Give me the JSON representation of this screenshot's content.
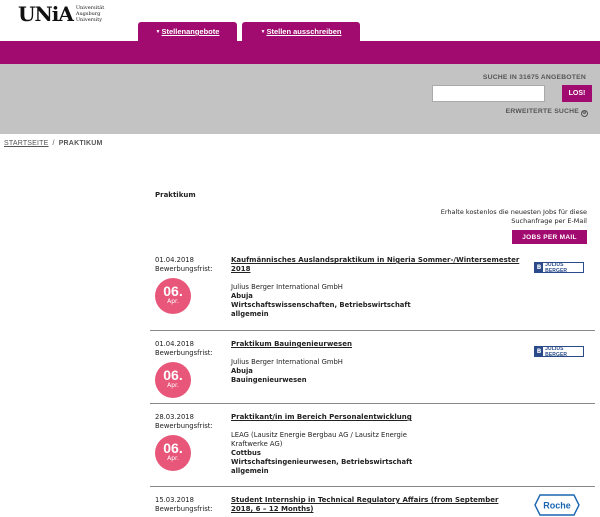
{
  "header": {
    "logo_mark": "UNiA",
    "logo_lines": [
      "Universität",
      "Augsburg",
      "University"
    ],
    "tabs": [
      {
        "label": "Stellenangebote"
      },
      {
        "label": "Stellen ausschreiben"
      }
    ]
  },
  "search": {
    "count_text": "SUCHE IN 31675 ANGEBOTEN",
    "input_value": "",
    "button_label": "LOS!",
    "advanced_label": "ERWEITERTE SUCHE"
  },
  "breadcrumb": {
    "home": "STARTSEITE",
    "separator": "/",
    "current": "PRAKTIKUM"
  },
  "page": {
    "title": "Praktikum",
    "alert_line1": "Erhalte kostenlos die neuesten Jobs für diese",
    "alert_line2": "Suchanfrage per E-Mail",
    "jobs_mail_button": "JOBS PER MAIL"
  },
  "jobs": [
    {
      "date": "01.04.2018",
      "deadline_label": "Bewerbungsfrist:",
      "badge_day": "06.",
      "badge_month": "Apr.",
      "title_line1": "Kaufmännisches Auslandspraktikum in Nigeria Sommer-/Wintersemester",
      "title_line2": "2018",
      "company": "Julius Berger International GmbH",
      "location": "Abuja",
      "field_line1": "Wirtschaftswissenschaften, Betriebswirtschaft",
      "field_line2": "allgemein",
      "logo": "JULIUS BERGER"
    },
    {
      "date": "01.04.2018",
      "deadline_label": "Bewerbungsfrist:",
      "badge_day": "06.",
      "badge_month": "Apr.",
      "title_line1": "Praktikum Bauingenieurwesen",
      "company": "Julius Berger International GmbH",
      "location": "Abuja",
      "field_line1": "Bauingenieurwesen",
      "logo": "JULIUS BERGER"
    },
    {
      "date": "28.03.2018",
      "deadline_label": "Bewerbungsfrist:",
      "badge_day": "06.",
      "badge_month": "Apr.",
      "title_line1": "Praktikant/in im Bereich Personalentwicklung",
      "company_line1": "LEAG (Lausitz Energie Bergbau AG / Lausitz Energie",
      "company_line2": "Kraftwerke AG)",
      "location": "Cottbus",
      "field_line1": "Wirtschaftsingenieurwesen, Betriebswirtschaft",
      "field_line2": "allgemein"
    },
    {
      "date": "15.03.2018",
      "deadline_label": "Bewerbungsfrist:",
      "title_line1": "Student Internship in Technical Regulatory Affairs (from September",
      "title_line2": "2018, 6 – 12 Months)",
      "logo": "Roche"
    }
  ],
  "colors": {
    "brand": "#a10a6e",
    "badge": "#e8577a",
    "search_band": "#c3c3c3"
  }
}
